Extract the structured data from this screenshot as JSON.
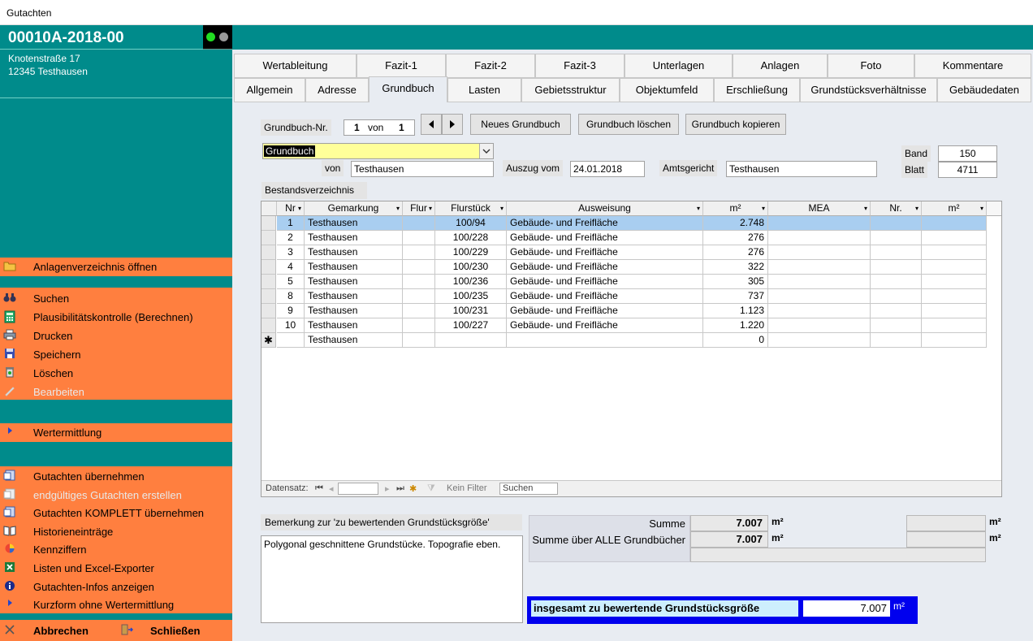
{
  "window": {
    "title": "Gutachten"
  },
  "sidebar": {
    "case_id": "00010A-2018-00",
    "address_line1": "Knotenstraße 17",
    "address_line2": "12345 Testhausen",
    "menu_top": [
      {
        "label": "Anlagenverzeichnis öffnen",
        "icon": "folder-icon"
      }
    ],
    "menu_main": [
      {
        "label": "Suchen",
        "icon": "binoculars-icon",
        "enabled": true
      },
      {
        "label": "Plausibilitätskontrolle (Berechnen)",
        "icon": "calculator-icon",
        "enabled": true
      },
      {
        "label": "Drucken",
        "icon": "printer-icon",
        "enabled": true
      },
      {
        "label": "Speichern",
        "icon": "save-icon",
        "enabled": true
      },
      {
        "label": "Löschen",
        "icon": "trash-icon",
        "enabled": true
      },
      {
        "label": "Bearbeiten",
        "icon": "pencil-icon",
        "enabled": false
      }
    ],
    "menu_mid": [
      {
        "label": "Wertermittlung",
        "icon": "arrow-right-icon"
      }
    ],
    "menu_bottom": [
      {
        "label": "Gutachten übernehmen",
        "icon": "document-import-icon",
        "enabled": true
      },
      {
        "label": "endgültiges Gutachten erstellen",
        "icon": "document-final-icon",
        "enabled": false
      },
      {
        "label": "Gutachten KOMPLETT übernehmen",
        "icon": "document-import-all-icon",
        "enabled": true
      },
      {
        "label": "Historieneinträge",
        "icon": "book-icon",
        "enabled": true
      },
      {
        "label": "Kennziffern",
        "icon": "chart-pie-icon",
        "enabled": true
      },
      {
        "label": "Listen und Excel-Exporter",
        "icon": "excel-icon",
        "enabled": true
      },
      {
        "label": "Gutachten-Infos anzeigen",
        "icon": "info-icon",
        "enabled": true
      },
      {
        "label": "Kurzform ohne Wertermittlung",
        "icon": "arrow-right-icon",
        "enabled": true
      }
    ],
    "footer": {
      "cancel_label": "Abbrechen",
      "close_label": "Schließen"
    },
    "colors": {
      "teal": "#008b8b",
      "orange": "#ff7f3f"
    }
  },
  "tabs_row1": [
    "Wertableitung",
    "Fazit-1",
    "Fazit-2",
    "Fazit-3",
    "Unterlagen",
    "Anlagen",
    "Foto",
    "Kommentare"
  ],
  "tabs_row2": [
    "Allgemein",
    "Adresse",
    "Grundbuch",
    "Lasten",
    "Gebietsstruktur",
    "Objektumfeld",
    "Erschließung",
    "Grundstücksverhältnisse",
    "Gebäudedaten"
  ],
  "active_tab": "Grundbuch",
  "grundbuch": {
    "nr_label": "Grundbuch-Nr.",
    "nr_current": "1",
    "von_label": "von",
    "nr_total": "1",
    "btn_new": "Neues Grundbuch",
    "btn_delete": "Grundbuch löschen",
    "btn_copy": "Grundbuch kopieren",
    "type_value": "Grundbuch",
    "von_field_label": "von",
    "von_value": "Testhausen",
    "auszug_label": "Auszug vom",
    "auszug_value": "24.01.2018",
    "amtsgericht_label": "Amtsgericht",
    "amtsgericht_value": "Testhausen",
    "band_label": "Band",
    "band_value": "150",
    "blatt_label": "Blatt",
    "blatt_value": "4711",
    "section_label": "Bestandsverzeichnis"
  },
  "table": {
    "headers": [
      "Nr",
      "Gemarkung",
      "Flur",
      "Flurstück",
      "Ausweisung",
      "m²",
      "MEA",
      "Nr.",
      "m²"
    ],
    "rows": [
      [
        "1",
        "Testhausen",
        "",
        "100/94",
        "Gebäude- und Freifläche",
        "2.748",
        "",
        "",
        ""
      ],
      [
        "2",
        "Testhausen",
        "",
        "100/228",
        "Gebäude- und Freifläche",
        "276",
        "",
        "",
        ""
      ],
      [
        "3",
        "Testhausen",
        "",
        "100/229",
        "Gebäude- und Freifläche",
        "276",
        "",
        "",
        ""
      ],
      [
        "4",
        "Testhausen",
        "",
        "100/230",
        "Gebäude- und Freifläche",
        "322",
        "",
        "",
        ""
      ],
      [
        "5",
        "Testhausen",
        "",
        "100/236",
        "Gebäude- und Freifläche",
        "305",
        "",
        "",
        ""
      ],
      [
        "8",
        "Testhausen",
        "",
        "100/235",
        "Gebäude- und Freifläche",
        "737",
        "",
        "",
        ""
      ],
      [
        "9",
        "Testhausen",
        "",
        "100/231",
        "Gebäude- und Freifläche",
        "1.123",
        "",
        "",
        ""
      ],
      [
        "10",
        "Testhausen",
        "",
        "100/227",
        "Gebäude- und Freifläche",
        "1.220",
        "",
        "",
        ""
      ]
    ],
    "new_row": [
      "",
      "Testhausen",
      "",
      "",
      "",
      "0",
      "",
      "",
      ""
    ],
    "new_row_marker": "✱",
    "nav": {
      "label": "Datensatz:",
      "no_filter": "Kein Filter",
      "search": "Suchen"
    }
  },
  "remark": {
    "label": "Bemerkung zur 'zu bewertenden Grundstücksgröße'",
    "text": "Polygonal geschnittene Grundstücke. Topografie eben."
  },
  "sums": {
    "summe_label": "Summe",
    "summe_value": "7.007",
    "alle_label": "Summe über ALLE Grundbücher",
    "alle_value": "7.007",
    "unit": "m²",
    "total_label": "insgesamt zu bewertende Grundstücksgröße",
    "total_value": "7.007"
  }
}
